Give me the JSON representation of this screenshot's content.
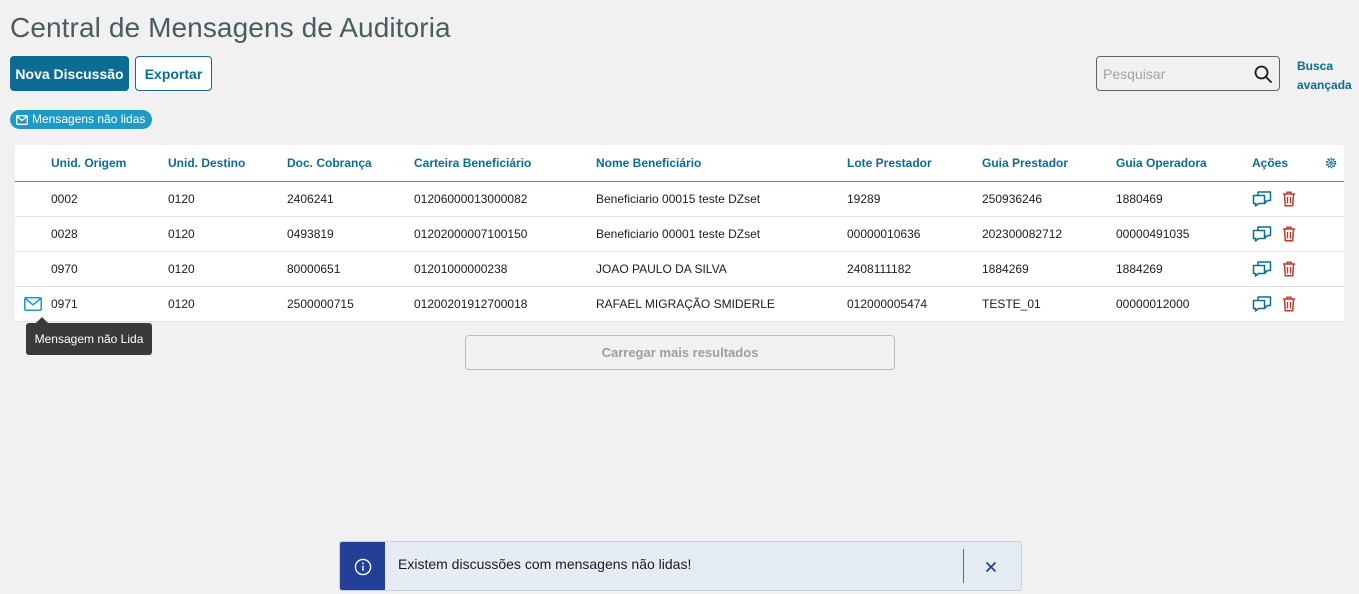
{
  "header": {
    "title": "Central de Mensagens de Auditoria"
  },
  "toolbar": {
    "new_discussion_label": "Nova Discussão",
    "export_label": "Exportar",
    "search_placeholder": "Pesquisar",
    "advanced_search_line1": "Busca",
    "advanced_search_line2": "avançada"
  },
  "filter": {
    "unread_label": "Mensagens não lidas"
  },
  "table": {
    "columns": [
      "Unid. Origem",
      "Unid. Destino",
      "Doc. Cobrança",
      "Carteira Beneficiário",
      "Nome Beneficiário",
      "Lote Prestador",
      "Guia Prestador",
      "Guia Operadora",
      "Ações"
    ],
    "rows": [
      {
        "unread": false,
        "cells": [
          "0002",
          "0120",
          "2406241",
          "01206000013000082",
          "Beneficiario 00015 teste DZset",
          "19289",
          "250936246",
          "1880469"
        ]
      },
      {
        "unread": false,
        "cells": [
          "0028",
          "0120",
          "0493819",
          "01202000007100150",
          "Beneficiario 00001 teste DZset",
          "00000010636",
          "202300082712",
          "00000491035"
        ]
      },
      {
        "unread": false,
        "cells": [
          "0970",
          "0120",
          "80000651",
          "01201000000238",
          "JOAO PAULO DA SILVA",
          "2408111182",
          "1884269",
          "1884269"
        ]
      },
      {
        "unread": true,
        "cells": [
          "0971",
          "0120",
          "2500000715",
          "01200201912700018",
          "RAFAEL MIGRAÇÃO SMIDERLE",
          "012000005474",
          "TESTE_01",
          "00000012000"
        ]
      }
    ]
  },
  "tooltip": {
    "text": "Mensagem não Lida"
  },
  "load_more": {
    "label": "Carregar mais resultados"
  },
  "toast": {
    "message": "Existem discussões com mensagens não lidas!"
  },
  "colors": {
    "primary": "#0c6c94",
    "accent": "#1e9ac4",
    "danger": "#c0392b",
    "toast_icon_bg": "#233f96"
  },
  "icons": [
    "search-icon",
    "envelope-icon",
    "gear-icon",
    "chat-icon",
    "trash-icon",
    "info-icon",
    "close-icon"
  ]
}
